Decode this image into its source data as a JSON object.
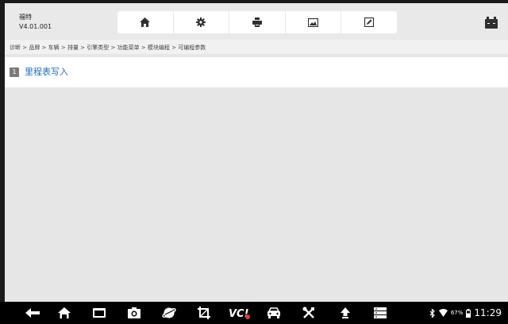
{
  "header": {
    "title": "福特",
    "version": "V4.01.001",
    "toolbar": [
      {
        "name": "home-icon"
      },
      {
        "name": "settings-icon"
      },
      {
        "name": "print-icon"
      },
      {
        "name": "image-icon"
      },
      {
        "name": "edit-icon"
      }
    ],
    "vci_icon": "vci-battery-icon"
  },
  "breadcrumb": "诊断 > 品牌 > 车辆 > 排量 > 引擎类型 > 功能菜单 > 模块编程 > 可编程参数",
  "menu": {
    "items": [
      {
        "number": "1",
        "label": "里程表写入"
      }
    ]
  },
  "navbar": {
    "buttons": [
      "back-icon",
      "home-icon",
      "recent-apps-icon",
      "camera-icon",
      "browser-icon",
      "crop-icon",
      "vci-icon",
      "car-icon",
      "tools-icon",
      "upload-icon",
      "menu-icon"
    ],
    "vci_label": "VC!"
  },
  "status": {
    "battery_percent": "67%",
    "time": "11:29"
  },
  "colors": {
    "header_bg": "#e9e9e9",
    "link": "#1a6bc8",
    "content_bg": "#e6e6e6"
  }
}
